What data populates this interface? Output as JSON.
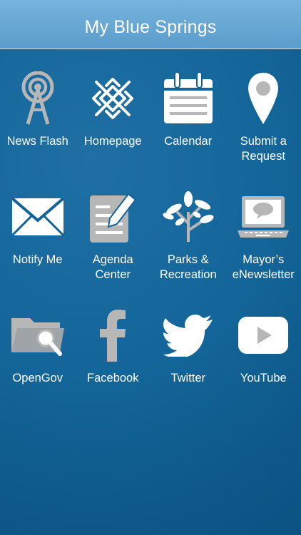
{
  "header": {
    "title": "My Blue Springs"
  },
  "tiles": [
    {
      "label": "News Flash",
      "icon": "broadcast-tower-icon"
    },
    {
      "label": "Homepage",
      "icon": "snowflake-logo-icon"
    },
    {
      "label": "Calendar",
      "icon": "calendar-icon"
    },
    {
      "label": "Submit a\nRequest",
      "icon": "map-pin-icon"
    },
    {
      "label": "Notify Me",
      "icon": "envelope-icon"
    },
    {
      "label": "Agenda\nCenter",
      "icon": "document-pen-icon"
    },
    {
      "label": "Parks &\nRecreation",
      "icon": "tree-icon"
    },
    {
      "label": "Mayor’s\neNewsletter",
      "icon": "laptop-chat-icon"
    },
    {
      "label": "OpenGov",
      "icon": "folder-search-icon"
    },
    {
      "label": "Facebook",
      "icon": "facebook-icon"
    },
    {
      "label": "Twitter",
      "icon": "twitter-bird-icon"
    },
    {
      "label": "YouTube",
      "icon": "youtube-play-icon"
    }
  ],
  "colors": {
    "header": "#6aa8d5",
    "background": "#12639a",
    "icon_gray": "#b7b7b7",
    "icon_white": "#ffffff"
  }
}
